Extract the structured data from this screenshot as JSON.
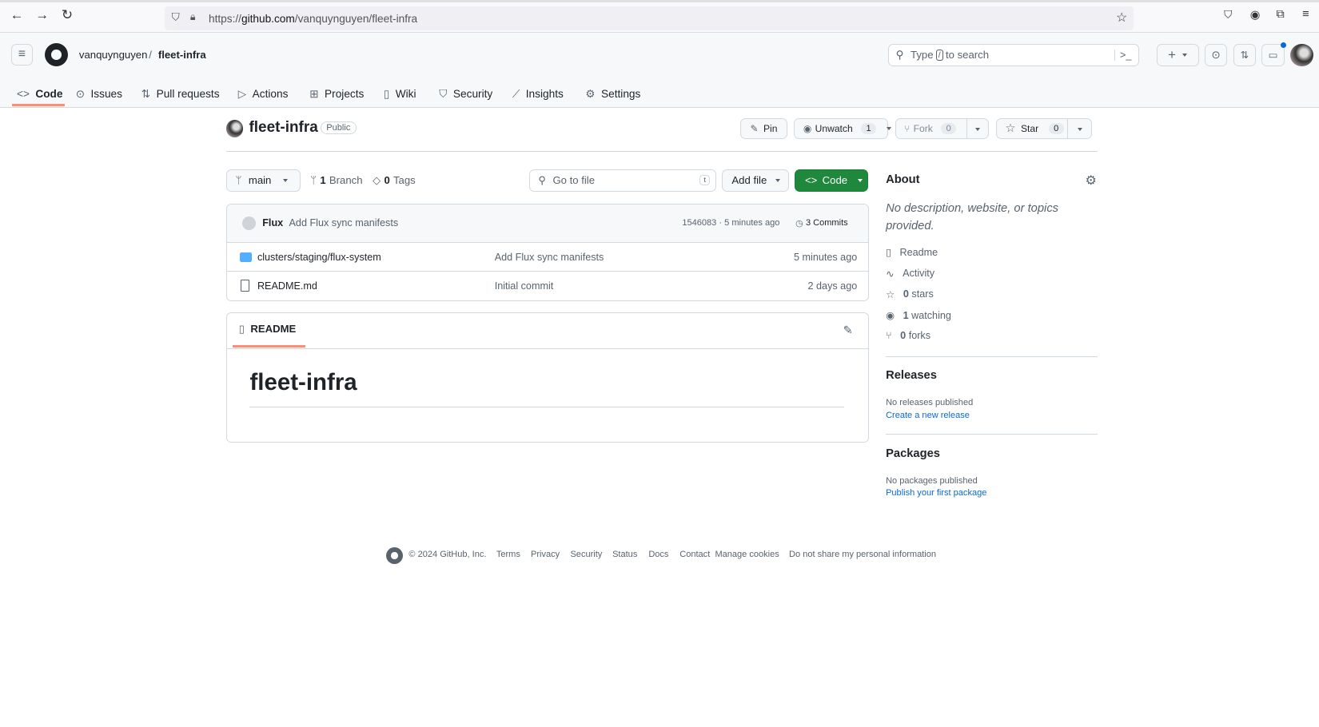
{
  "browser": {
    "url_prefix": "https://",
    "url_domain": "github.com",
    "url_path": "/vanquynguyen/fleet-infra"
  },
  "header": {
    "owner": "vanquynguyen",
    "separator": "/",
    "repo": "fleet-infra",
    "search_prefix": "Type",
    "search_key": "/",
    "search_suffix": "to search"
  },
  "nav": [
    {
      "label": "Code"
    },
    {
      "label": "Issues"
    },
    {
      "label": "Pull requests"
    },
    {
      "label": "Actions"
    },
    {
      "label": "Projects"
    },
    {
      "label": "Wiki"
    },
    {
      "label": "Security"
    },
    {
      "label": "Insights"
    },
    {
      "label": "Settings"
    }
  ],
  "repo": {
    "name": "fleet-infra",
    "visibility": "Public",
    "pin": "Pin",
    "unwatch": "Unwatch",
    "watch_count": "1",
    "fork": "Fork",
    "fork_count": "0",
    "star": "Star",
    "star_count": "0"
  },
  "toolbar": {
    "branch": "main",
    "branch_count": "1",
    "branch_label": "Branch",
    "tag_count": "0",
    "tag_label": "Tags",
    "go_to_file": "Go to file",
    "shortcut": "t",
    "add_file": "Add file",
    "code": "Code"
  },
  "commit": {
    "author": "Flux",
    "message": "Add Flux sync manifests",
    "sha": "1546083 · 5 minutes ago",
    "commits": "3 Commits"
  },
  "files": [
    {
      "name": "clusters/staging/flux-system",
      "type": "folder",
      "message": "Add Flux sync manifests",
      "time": "5 minutes ago"
    },
    {
      "name": "README.md",
      "type": "file",
      "message": "Initial commit",
      "time": "2 days ago"
    }
  ],
  "readme": {
    "tab": "README",
    "heading": "fleet-infra"
  },
  "about": {
    "title": "About",
    "description": "No description, website, or topics provided.",
    "readme": "Readme",
    "activity": "Activity",
    "stars_count": "0",
    "stars": "stars",
    "watching_count": "1",
    "watching": "watching",
    "forks_count": "0",
    "forks": "forks"
  },
  "releases": {
    "title": "Releases",
    "empty": "No releases published",
    "link": "Create a new release"
  },
  "packages": {
    "title": "Packages",
    "empty": "No packages published",
    "link": "Publish your first package"
  },
  "footer": {
    "copyright": "© 2024 GitHub, Inc.",
    "links": [
      "Terms",
      "Privacy",
      "Security",
      "Status",
      "Docs",
      "Contact",
      "Manage cookies",
      "Do not share my personal information"
    ]
  },
  "colors": {
    "green": "#1f883d",
    "accent_underline": "#fd8c73",
    "link": "#0969da"
  }
}
